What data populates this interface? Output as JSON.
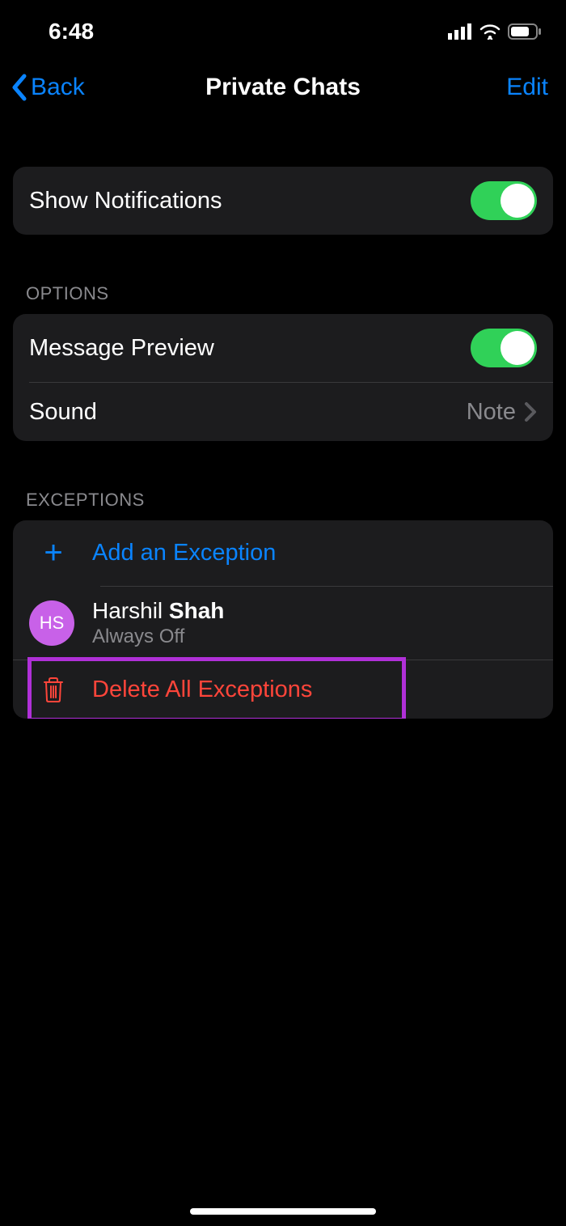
{
  "status": {
    "time": "6:48"
  },
  "nav": {
    "back": "Back",
    "title": "Private Chats",
    "edit": "Edit"
  },
  "notifications": {
    "show_label": "Show Notifications",
    "show_on": true
  },
  "options": {
    "header": "Options",
    "message_preview_label": "Message Preview",
    "message_preview_on": true,
    "sound_label": "Sound",
    "sound_value": "Note"
  },
  "exceptions": {
    "header": "Exceptions",
    "add_label": "Add an Exception",
    "items": [
      {
        "initials": "HS",
        "name_first": "Harshil",
        "name_last": "Shah",
        "sub": "Always Off"
      }
    ],
    "delete_label": "Delete All Exceptions"
  }
}
